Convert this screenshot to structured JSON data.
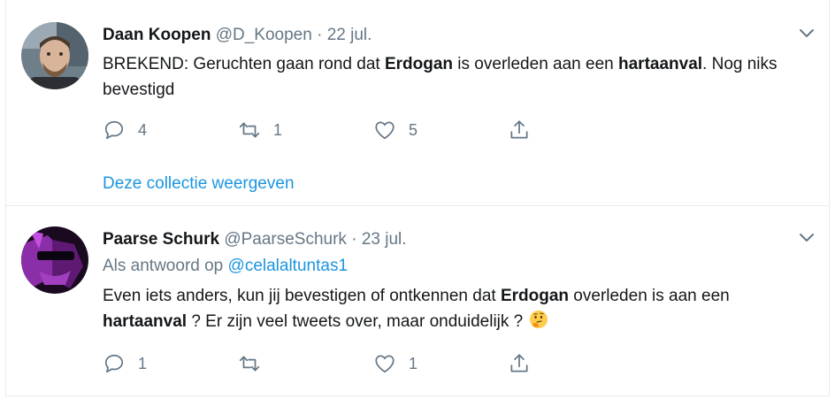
{
  "tweets": [
    {
      "name": "Daan Koopen",
      "handle": "@D_Koopen",
      "separator": "·",
      "date": "22 jul.",
      "text_parts": [
        "BREKEND: Geruchten gaan rond dat ",
        "Erdogan",
        " is overleden aan een ",
        "hartaanval",
        ". Nog niks bevestigd"
      ],
      "replies": "4",
      "retweets": "1",
      "likes": "5",
      "collection_link": "Deze collectie weergeven"
    },
    {
      "name": "Paarse Schurk",
      "handle": "@PaarseSchurk",
      "separator": "·",
      "date": "23 jul.",
      "reply_prefix": "Als antwoord op",
      "reply_mention": "@celalaltuntas1",
      "text_parts": [
        "Even iets anders, kun jij bevestigen of ontkennen dat ",
        "Erdogan",
        " overleden is aan een ",
        "hartaanval",
        " ? Er zijn veel tweets over, maar onduidelijk ? "
      ],
      "emoji": "thinking-face-emoji",
      "replies": "1",
      "retweets": "",
      "likes": "1"
    }
  ],
  "icons": {
    "reply": "reply-icon",
    "retweet": "retweet-icon",
    "like": "heart-icon",
    "share": "share-icon",
    "caret": "chevron-down-icon"
  },
  "colors": {
    "link": "#1b95e0",
    "secondary_text": "#657786",
    "primary_text": "#14171a",
    "border": "#e6ecf0"
  }
}
